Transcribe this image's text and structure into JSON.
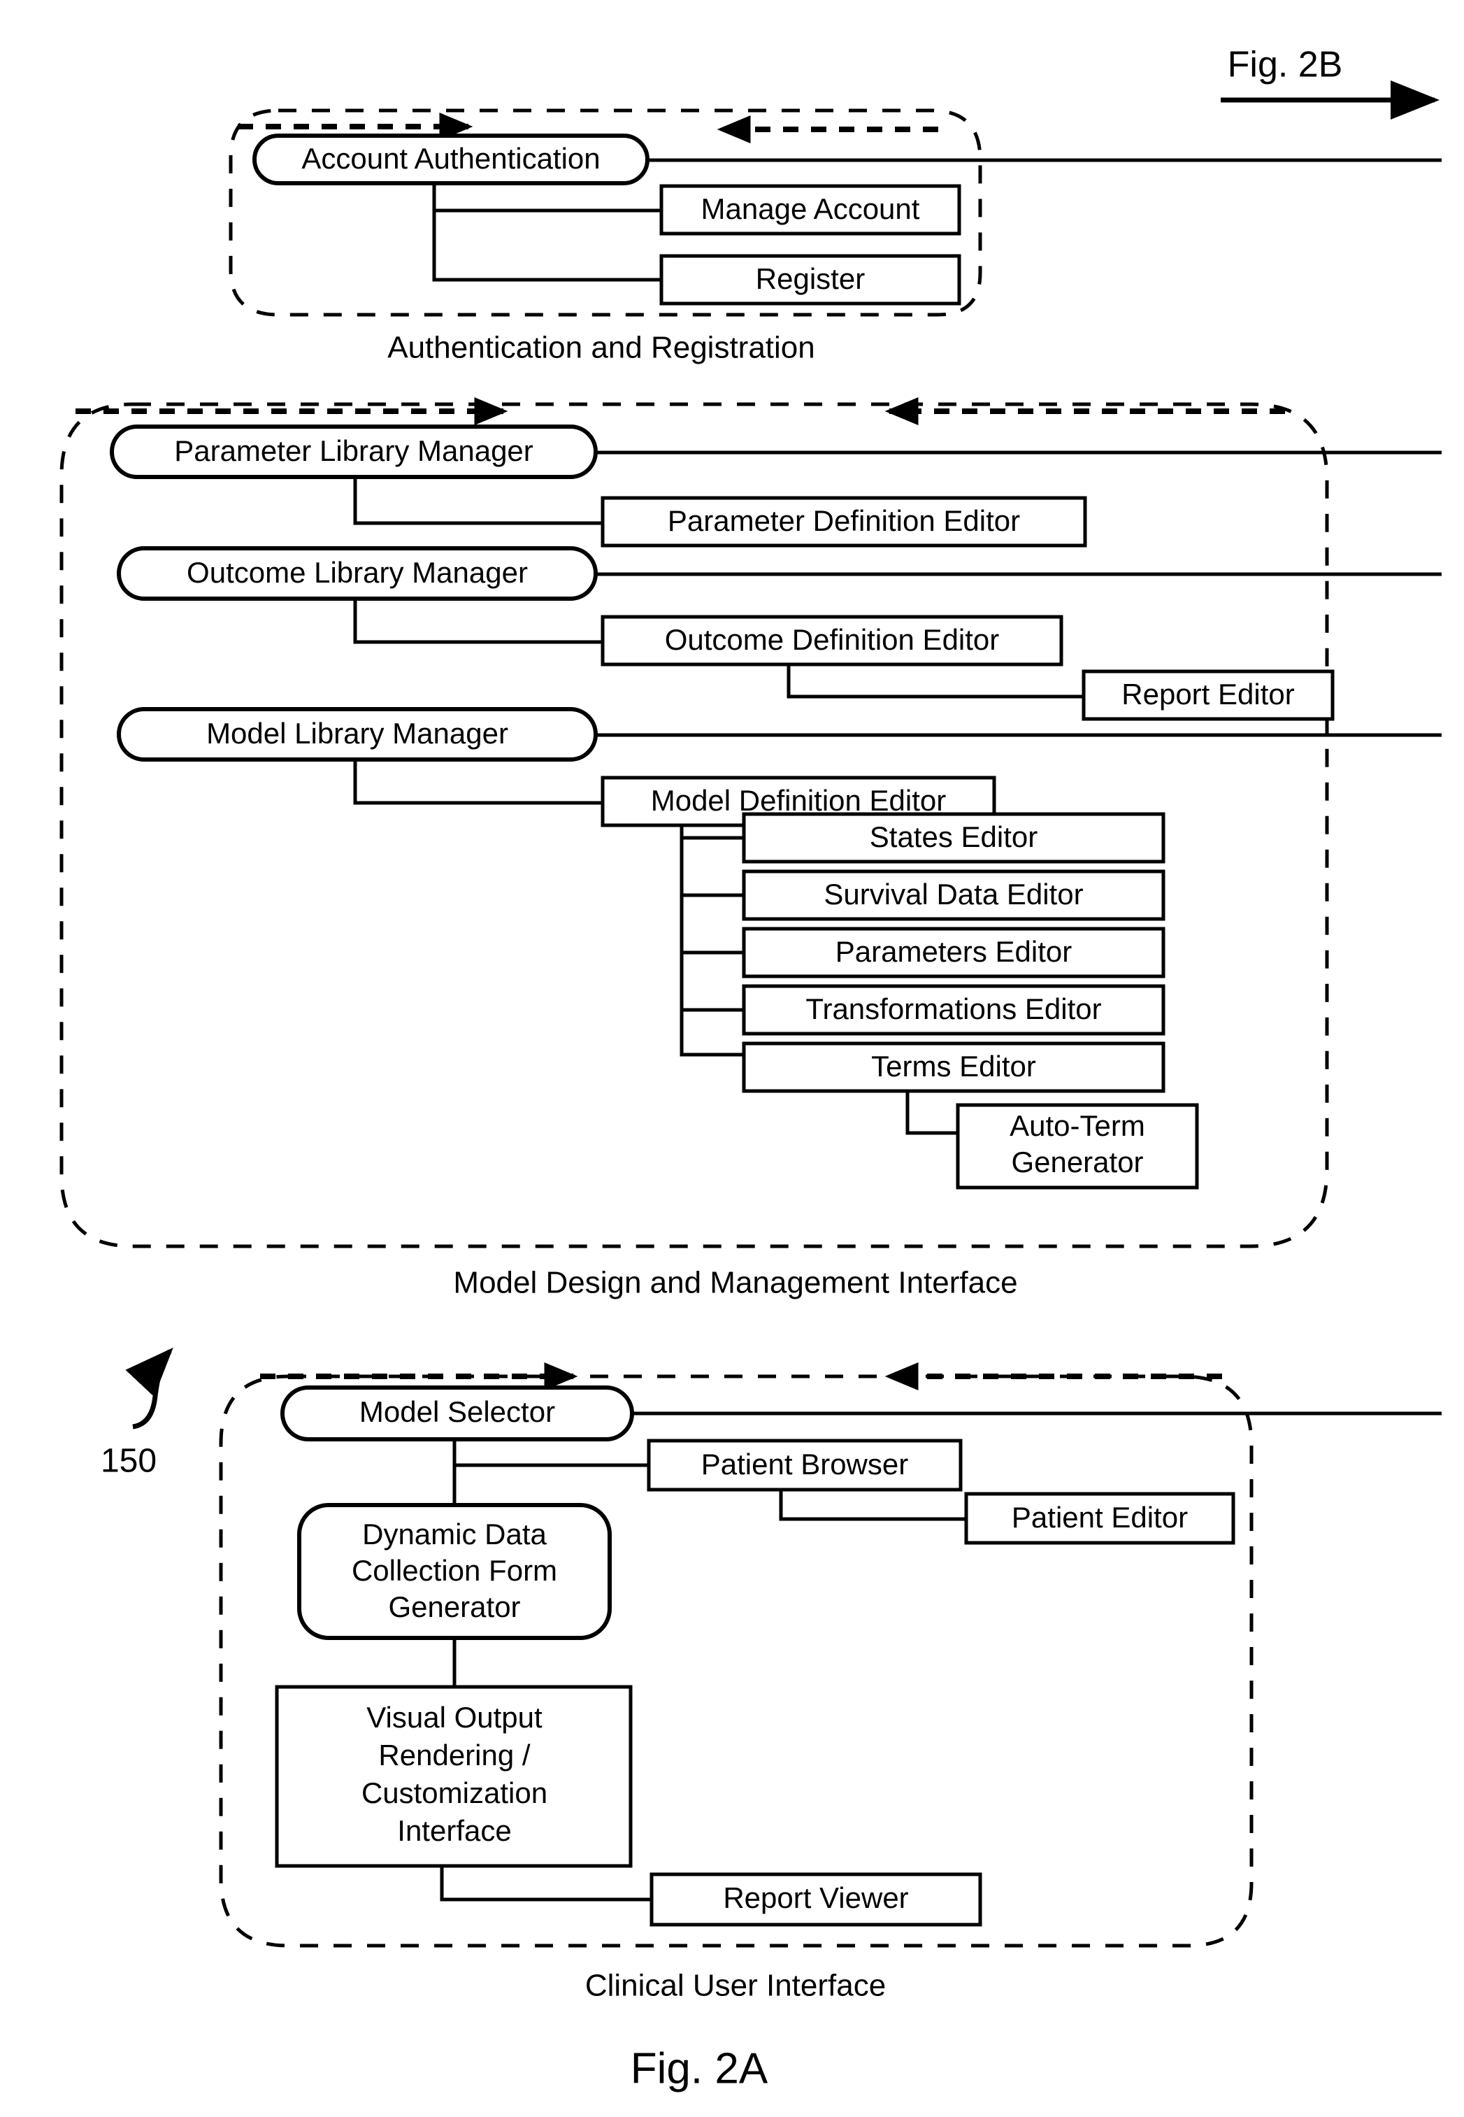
{
  "figure": {
    "main_label": "Fig. 2A",
    "continuation_label": "Fig. 2B",
    "reference_numeral": "150"
  },
  "groups": [
    {
      "id": "authentication-registration",
      "label": "Authentication and Registration",
      "nodes": {
        "primary": "Account Authentication",
        "children": [
          "Manage Account",
          "Register"
        ]
      }
    },
    {
      "id": "model-design-management",
      "label": "Model Design and Management Interface",
      "nodes": {
        "primaries": [
          "Parameter Library Manager",
          "Outcome Library Manager",
          "Model Library Manager"
        ],
        "parameter_child": "Parameter Definition Editor",
        "outcome_child": "Outcome Definition Editor",
        "outcome_grandchild": "Report Editor",
        "model_child": "Model Definition Editor",
        "model_grandchildren": [
          "States Editor",
          "Survival Data Editor",
          "Parameters Editor",
          "Transformations Editor",
          "Terms Editor"
        ],
        "terms_child_line1": "Auto-Term",
        "terms_child_line2": "Generator"
      }
    },
    {
      "id": "clinical-user-interface",
      "label": "Clinical User Interface",
      "nodes": {
        "primary": "Model Selector",
        "patient_browser": "Patient Browser",
        "patient_editor": "Patient Editor",
        "form_generator_line1": "Dynamic Data",
        "form_generator_line2": "Collection Form",
        "form_generator_line3": "Generator",
        "visual_output_line1": "Visual Output",
        "visual_output_line2": "Rendering /",
        "visual_output_line3": "Customization",
        "visual_output_line4": "Interface",
        "report_viewer": "Report Viewer"
      }
    }
  ],
  "colors": {
    "ink": "#000000",
    "paper": "#ffffff"
  }
}
